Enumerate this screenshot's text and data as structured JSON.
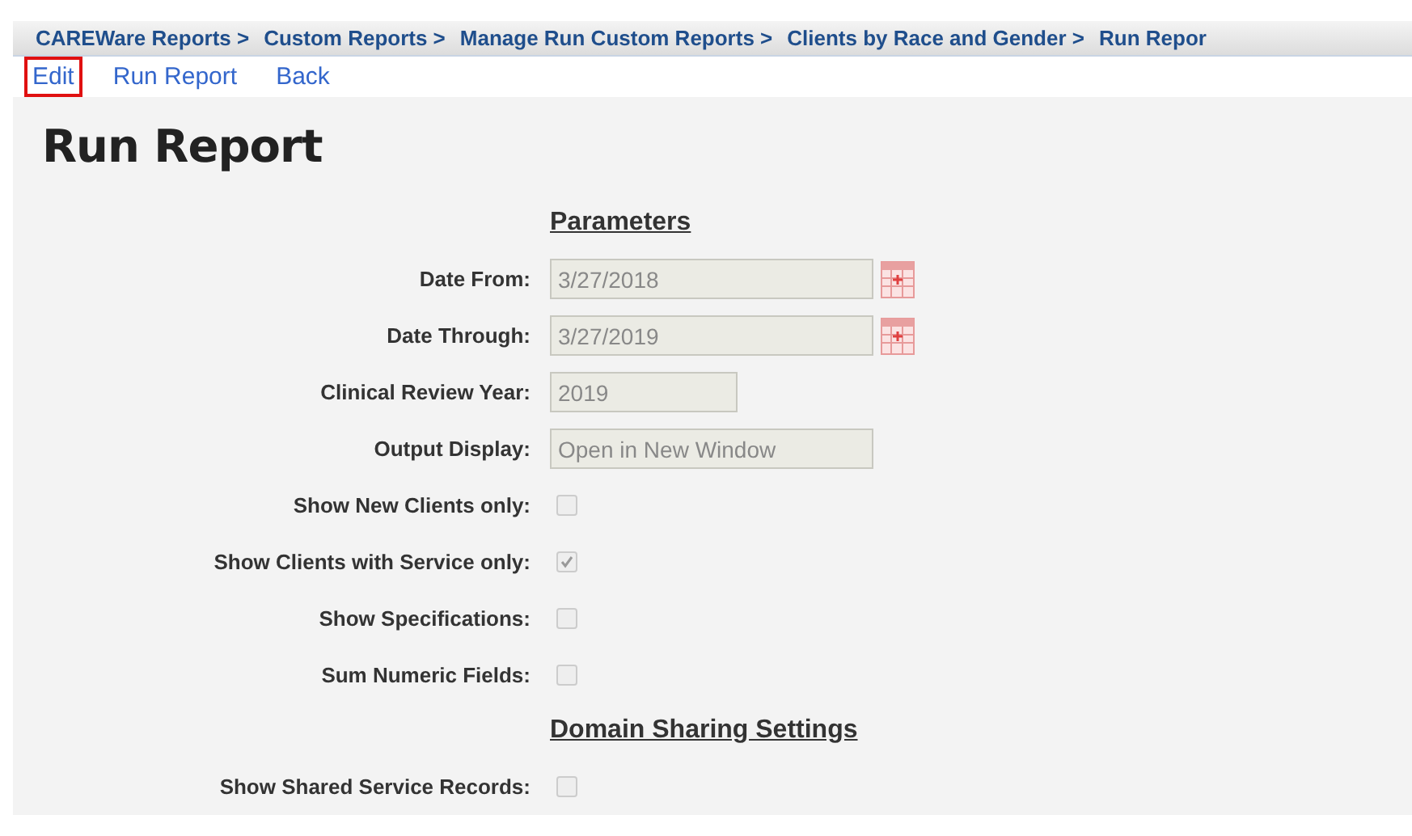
{
  "breadcrumb": [
    "CAREWare Reports >",
    "Custom Reports >",
    "Manage Run Custom Reports >",
    "Clients by Race and Gender >",
    "Run Repor"
  ],
  "links": [
    {
      "label": "Edit",
      "highlighted": true
    },
    {
      "label": "Run Report",
      "highlighted": false
    },
    {
      "label": "Back",
      "highlighted": false
    }
  ],
  "title": "Run Report",
  "sections": [
    {
      "heading": "Parameters",
      "rows": [
        {
          "kind": "date",
          "label": "Date From:",
          "value": "3/27/2018",
          "disabled": true
        },
        {
          "kind": "date",
          "label": "Date Through:",
          "value": "3/27/2019",
          "disabled": true
        },
        {
          "kind": "short",
          "label": "Clinical Review Year:",
          "value": "2019",
          "disabled": true
        },
        {
          "kind": "text",
          "label": "Output Display:",
          "value": "Open in New Window",
          "disabled": true
        },
        {
          "kind": "checkbox",
          "label": "Show New Clients only:",
          "checked": false,
          "disabled": true
        },
        {
          "kind": "checkbox",
          "label": "Show Clients with Service only:",
          "checked": true,
          "disabled": true
        },
        {
          "kind": "checkbox",
          "label": "Show Specifications:",
          "checked": false,
          "disabled": true
        },
        {
          "kind": "checkbox",
          "label": "Sum Numeric Fields:",
          "checked": false,
          "disabled": true
        }
      ]
    },
    {
      "heading": "Domain Sharing Settings",
      "rows": [
        {
          "kind": "checkbox",
          "label": "Show Shared Service Records:",
          "checked": false,
          "disabled": true
        }
      ]
    }
  ]
}
